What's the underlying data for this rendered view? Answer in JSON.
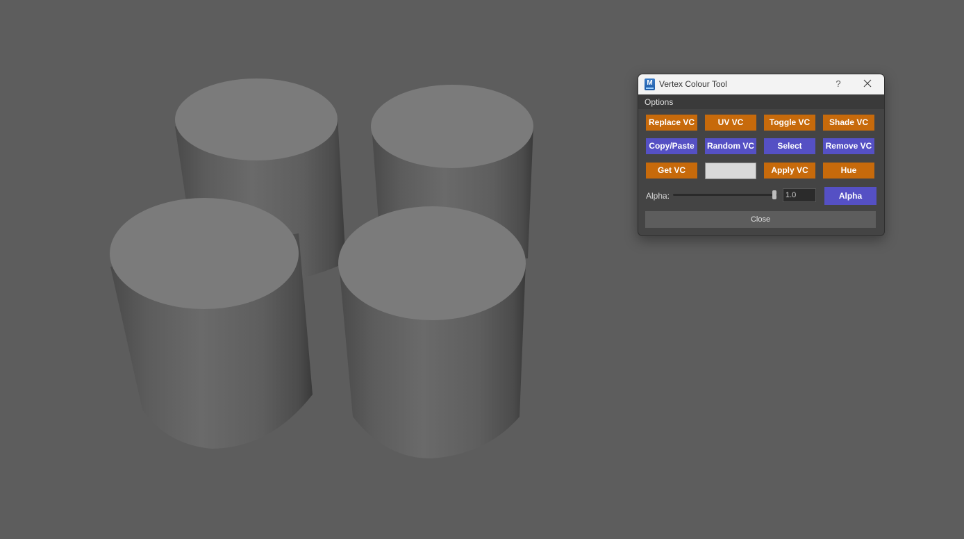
{
  "window": {
    "title": "Vertex Colour Tool",
    "icon_letter": "M",
    "help_label": "?",
    "close_icon": "close-icon"
  },
  "menu": {
    "options_label": "Options"
  },
  "buttons": {
    "row1": [
      "Replace VC",
      "UV VC",
      "Toggle VC",
      "Shade VC"
    ],
    "row2": [
      "Copy/Paste",
      "Random VC",
      "Select",
      "Remove VC"
    ],
    "row3": [
      "Get VC",
      "Apply VC",
      "Hue"
    ]
  },
  "colour_swatch": {
    "color": "#d9d9d9"
  },
  "alpha": {
    "label": "Alpha:",
    "value": "1.0",
    "slider_level": 1.0,
    "button_label": "Alpha"
  },
  "close_label": "Close",
  "colors": {
    "orange_button": "#c76a0b",
    "purple_button": "#5550c4",
    "viewport_background": "#5d5d5d"
  }
}
